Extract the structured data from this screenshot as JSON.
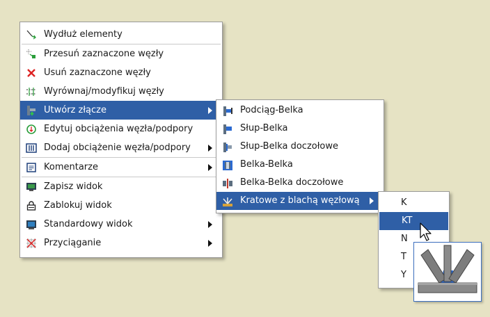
{
  "main_menu": {
    "items": [
      {
        "label": "Wydłuż elementy",
        "icon": "extend-elements-icon"
      },
      {
        "label": "Przesuń zaznaczone węzły",
        "icon": "move-nodes-icon"
      },
      {
        "label": "Usuń zaznaczone węzły",
        "icon": "delete-x-icon"
      },
      {
        "label": "Wyrównaj/modyfikuj węzły",
        "icon": "align-nodes-icon"
      },
      {
        "label": "Utwórz złącze",
        "icon": "create-joint-icon"
      },
      {
        "label": "Edytuj obciążenia węzła/podpory",
        "icon": "edit-load-icon"
      },
      {
        "label": "Dodaj obciążenie węzła/podpory",
        "icon": "add-load-icon"
      },
      {
        "label": "Komentarze",
        "icon": "comment-icon"
      },
      {
        "label": "Zapisz widok",
        "icon": "save-view-icon"
      },
      {
        "label": "Zablokuj widok",
        "icon": "lock-view-icon"
      },
      {
        "label": "Standardowy widok",
        "icon": "standard-view-icon"
      },
      {
        "label": "Przyciąganie",
        "icon": "snap-icon"
      }
    ]
  },
  "joint_submenu": {
    "items": [
      {
        "label": "Podciąg-Belka",
        "icon": "girder-beam-icon"
      },
      {
        "label": "Słup-Belka",
        "icon": "column-beam-icon"
      },
      {
        "label": "Słup-Belka doczołowe",
        "icon": "column-beam-endplate-icon"
      },
      {
        "label": "Belka-Belka",
        "icon": "beam-beam-icon"
      },
      {
        "label": "Belka-Belka doczołowe",
        "icon": "beam-beam-endplate-icon"
      },
      {
        "label": "Kratowe z blachą węzłową",
        "icon": "truss-gusset-icon"
      }
    ]
  },
  "truss_submenu": {
    "items": [
      "K",
      "KT",
      "N",
      "T",
      "Y"
    ],
    "selected": "KT"
  },
  "colors": {
    "highlight": "#2f5fa6",
    "background": "#e6e3c4",
    "preview_plate": "#2b6ad1",
    "preview_steel": "#7d7d7d"
  }
}
